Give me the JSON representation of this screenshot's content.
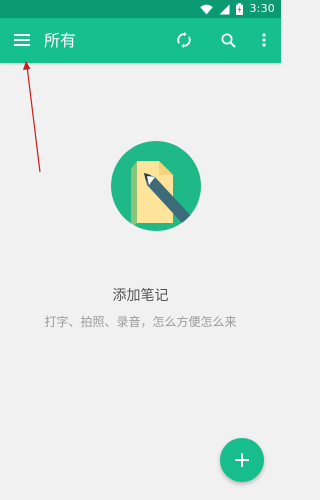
{
  "status_bar": {
    "time": "3:30",
    "icons": [
      "wifi-icon",
      "signal-icon",
      "battery-icon"
    ]
  },
  "toolbar": {
    "title": "所有",
    "icons": [
      "menu-icon",
      "sync-icon",
      "search-icon",
      "more-vert-icon"
    ]
  },
  "empty_state": {
    "title": "添加笔记",
    "subtitle": "打字、拍照、录音，怎么方便怎么来",
    "illustration": "note-pencil-icon"
  },
  "fab": {
    "icon": "plus-icon"
  },
  "colors": {
    "status_bar": "#0c9a72",
    "toolbar": "#16bf8e",
    "accent": "#17bd8c",
    "illustration_circle": "#1fb887",
    "paper": "#fde49a",
    "pencil": "#3e6b7a",
    "annotation_arrow": "#c81e1e"
  }
}
